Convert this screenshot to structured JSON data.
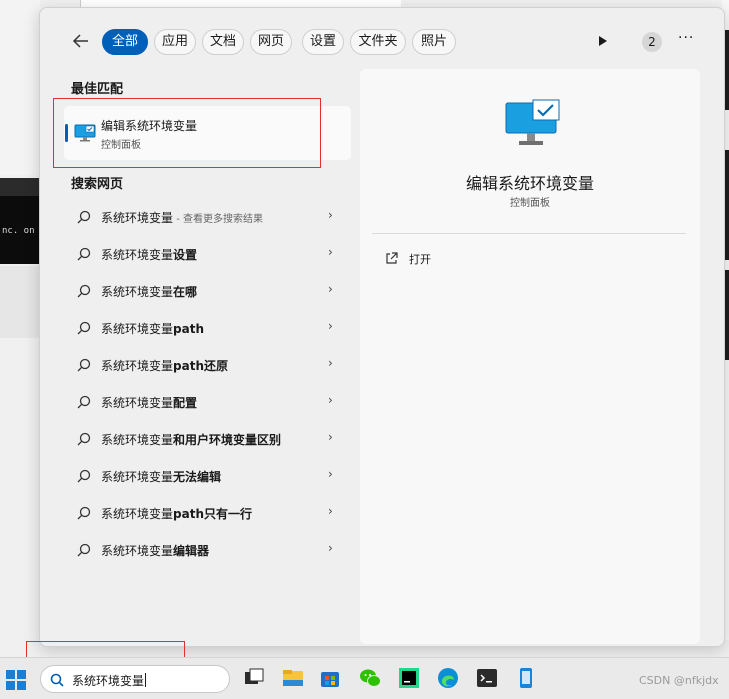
{
  "filters": {
    "back_icon": "arrow-left-icon",
    "tabs": [
      {
        "label": "全部",
        "active": true
      },
      {
        "label": "应用",
        "active": false
      },
      {
        "label": "文档",
        "active": false
      },
      {
        "label": "网页",
        "active": false
      },
      {
        "label": "设置",
        "active": false
      },
      {
        "label": "文件夹",
        "active": false
      },
      {
        "label": "照片",
        "active": false
      }
    ],
    "badge_count": "2",
    "more_label": "···"
  },
  "best_match": {
    "heading": "最佳匹配",
    "name": "编辑系统环境变量",
    "subtitle": "控制面板"
  },
  "web": {
    "heading": "搜索网页",
    "results": [
      {
        "base": "系统环境变量",
        "suffix": "",
        "hint": " - 查看更多搜索结果"
      },
      {
        "base": "系统环境变量",
        "suffix": "设置",
        "hint": ""
      },
      {
        "base": "系统环境变量",
        "suffix": "在哪",
        "hint": ""
      },
      {
        "base": "系统环境变量",
        "suffix": "path",
        "hint": ""
      },
      {
        "base": "系统环境变量",
        "suffix": "path还原",
        "hint": ""
      },
      {
        "base": "系统环境变量",
        "suffix": "配置",
        "hint": ""
      },
      {
        "base": "系统环境变量",
        "suffix": "和用户环境变量区别",
        "hint": ""
      },
      {
        "base": "系统环境变量",
        "suffix": "无法编辑",
        "hint": ""
      },
      {
        "base": "系统环境变量",
        "suffix": "path只有一行",
        "hint": ""
      },
      {
        "base": "系统环境变量",
        "suffix": "编辑器",
        "hint": ""
      }
    ]
  },
  "preview": {
    "title": "编辑系统环境变量",
    "subtitle": "控制面板",
    "action_open": "打开"
  },
  "taskbar": {
    "search_value": "系统环境变量",
    "apps": [
      "task-view-icon",
      "file-explorer-icon",
      "microsoft-store-icon",
      "wechat-icon",
      "pycharm-icon",
      "edge-icon",
      "terminal-icon",
      "phone-link-icon"
    ]
  },
  "background": {
    "terminal_text": "nc. on …"
  },
  "watermark": "CSDN @nfkjdx",
  "colors": {
    "accent": "#005fb8",
    "highlight_box": "#e03030"
  }
}
